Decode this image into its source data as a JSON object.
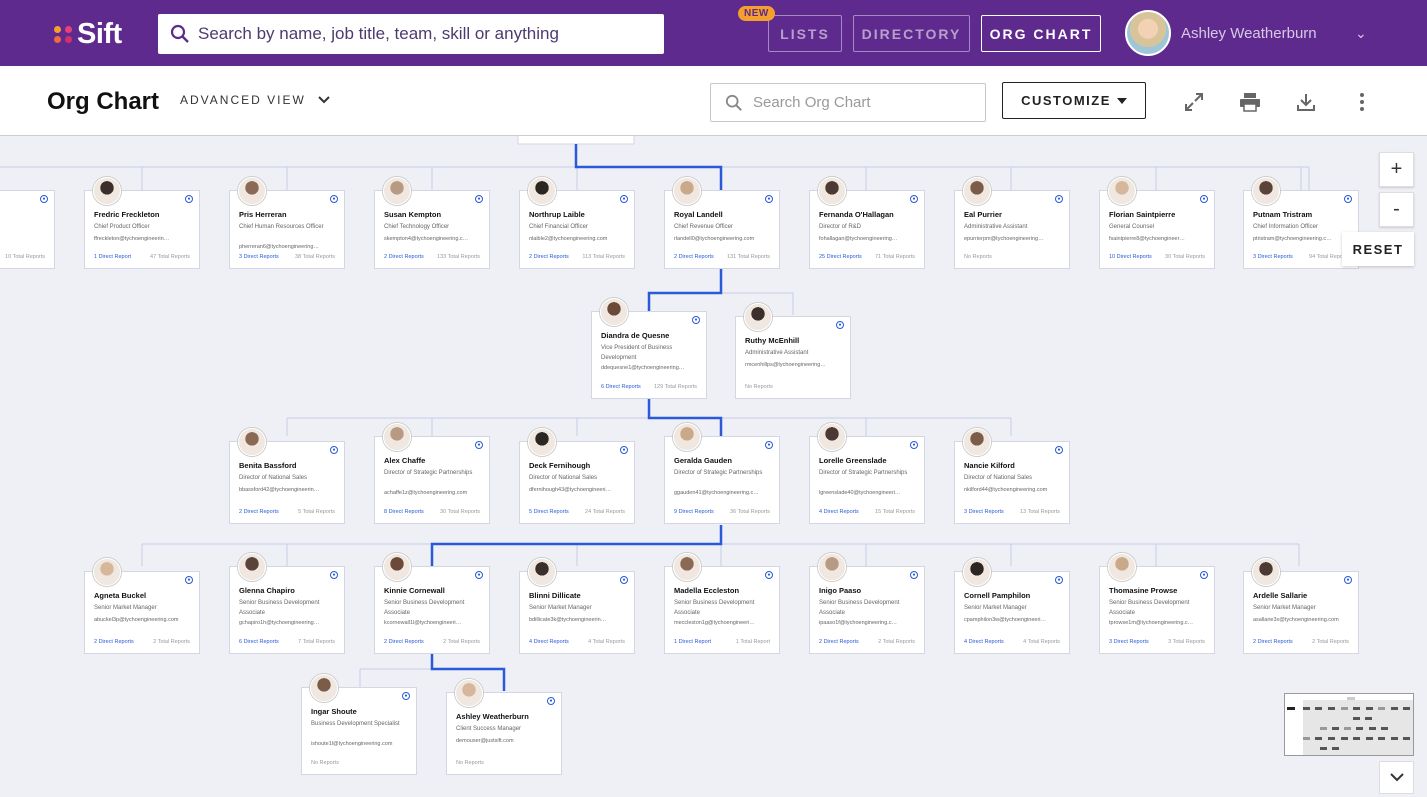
{
  "topbar": {
    "logo_text": "Sift",
    "search_placeholder": "Search by name, job title, team, skill or anything",
    "new_badge": "NEW",
    "nav": [
      {
        "label": "LISTS",
        "active": false
      },
      {
        "label": "DIRECTORY",
        "active": false
      },
      {
        "label": "ORG CHART",
        "active": true
      }
    ],
    "user_name": "Ashley Weatherburn"
  },
  "toolbar": {
    "title": "Org Chart",
    "view_label": "ADVANCED VIEW",
    "search_placeholder": "Search Org Chart",
    "customize_label": "CUSTOMIZE"
  },
  "controls": {
    "zoom_in": "+",
    "zoom_out": "-",
    "reset": "RESET"
  },
  "colors": {
    "brand": "#5f2a8e",
    "accent_line": "#2a5ad7",
    "badge": "#f5a02c"
  },
  "row1": [
    {
      "name": "…on",
      "title": "",
      "email": "…ngineering.com",
      "direct": "",
      "total": "10 Total Reports"
    },
    {
      "name": "Fredric Freckleton",
      "title": "Chief Product Officer",
      "email": "ffreckleton@tychoengineerin…",
      "direct": "1 Direct Report",
      "total": "47 Total Reports"
    },
    {
      "name": "Pris Herreran",
      "title": "Chief Human Resources Officer",
      "email": "pherreran6@tychoengineering…",
      "direct": "3 Direct Reports",
      "total": "38 Total Reports"
    },
    {
      "name": "Susan Kempton",
      "title": "Chief Technology Officer",
      "email": "skempton4@tychoengineering.c…",
      "direct": "2 Direct Reports",
      "total": "133 Total Reports"
    },
    {
      "name": "Northrup Laible",
      "title": "Chief Financial Officer",
      "email": "nlaible2@tychoengineering.com",
      "direct": "2 Direct Reports",
      "total": "113 Total Reports"
    },
    {
      "name": "Royal Landell",
      "title": "Chief Revenue Officer",
      "email": "rlandell0@tychoengineering.com",
      "direct": "2 Direct Reports",
      "total": "131 Total Reports"
    },
    {
      "name": "Fernanda O'Hallagan",
      "title": "Director of R&D",
      "email": "fohallagan@tychoengineering…",
      "direct": "25 Direct Reports",
      "total": "71 Total Reports"
    },
    {
      "name": "Eal Purrier",
      "title": "Administrative Assistant",
      "email": "epurrierpm@tychoengineering…",
      "direct": "",
      "total": "",
      "none": "No Reports"
    },
    {
      "name": "Florian Saintpierre",
      "title": "General Counsel",
      "email": "fsaintpierre8@tychoengineer…",
      "direct": "10 Direct Reports",
      "total": "30 Total Reports"
    },
    {
      "name": "Putnam Tristram",
      "title": "Chief Information Officer",
      "email": "ptristram@tychoengineering.c…",
      "direct": "3 Direct Reports",
      "total": "94 Total Reports"
    }
  ],
  "row2": [
    {
      "name": "Diandra de Quesne",
      "title": "Vice President of Business Development",
      "email": "ddequesne1@tychoengineering…",
      "direct": "6 Direct Reports",
      "total": "129 Total Reports"
    },
    {
      "name": "Ruthy McEnhill",
      "title": "Administrative Assistant",
      "email": "rmcenhillps@tychoengineering…",
      "direct": "",
      "total": "",
      "none": "No Reports"
    }
  ],
  "row3": [
    {
      "name": "Benita Bassford",
      "title": "Director of National Sales",
      "email": "bbassford42@tychoengineerin…",
      "direct": "2 Direct Reports",
      "total": "5 Total Reports"
    },
    {
      "name": "Alex Chaffe",
      "title": "Director of Strategic Partnerships",
      "email": "achaffe1z@tychoengineering.com",
      "direct": "8 Direct Reports",
      "total": "30 Total Reports"
    },
    {
      "name": "Deck Fernihough",
      "title": "Director of National Sales",
      "email": "dfernihough43@tychoengineeri…",
      "direct": "5 Direct Reports",
      "total": "24 Total Reports"
    },
    {
      "name": "Geralda Gauden",
      "title": "Director of Strategic Partnerships",
      "email": "ggauden41@tychoengineering.c…",
      "direct": "9 Direct Reports",
      "total": "36 Total Reports"
    },
    {
      "name": "Lorelle Greenslade",
      "title": "Director of Strategic Partnerships",
      "email": "lgreenslade40@tychoengineeri…",
      "direct": "4 Direct Reports",
      "total": "15 Total Reports"
    },
    {
      "name": "Nancie Kilford",
      "title": "Director of National Sales",
      "email": "nkilford44@tychoengineering.com",
      "direct": "3 Direct Reports",
      "total": "13 Total Reports"
    }
  ],
  "row4": [
    {
      "name": "Agneta Buckel",
      "title": "Senior Market Manager",
      "email": "abuckel3p@tychoengineering.com",
      "direct": "2 Direct Reports",
      "total": "2 Total Reports"
    },
    {
      "name": "Glenna Chapiro",
      "title": "Senior Business Development Associate",
      "email": "gchapiro1h@tychoengineering…",
      "direct": "6 Direct Reports",
      "total": "7 Total Reports"
    },
    {
      "name": "Kinnie Cornewall",
      "title": "Senior Business Development Associate",
      "email": "kcornewall1l@tychoengineeri…",
      "direct": "2 Direct Reports",
      "total": "2 Total Reports"
    },
    {
      "name": "Blinni Dillicate",
      "title": "Senior Market Manager",
      "email": "bdillicate3k@tychoengineerin…",
      "direct": "4 Direct Reports",
      "total": "4 Total Reports"
    },
    {
      "name": "Madella Eccleston",
      "title": "Senior Business Development Associate",
      "email": "meccleston1g@tychoengineeri…",
      "direct": "1 Direct Report",
      "total": "1 Total Report"
    },
    {
      "name": "Inigo Paaso",
      "title": "Senior Business Development Associate",
      "email": "ipaaso1f@tychoengineering.c…",
      "direct": "2 Direct Reports",
      "total": "2 Total Reports"
    },
    {
      "name": "Cornell Pamphilon",
      "title": "Senior Market Manager",
      "email": "cpamphilon3w@tychoengineeri…",
      "direct": "4 Direct Reports",
      "total": "4 Total Reports"
    },
    {
      "name": "Thomasine Prowse",
      "title": "Senior Business Development Associate",
      "email": "tprowse1m@tychoengineering.c…",
      "direct": "3 Direct Reports",
      "total": "3 Total Reports"
    },
    {
      "name": "Ardelle Sallarie",
      "title": "Senior Market Manager",
      "email": "asallarie3x@tychoengineering.com",
      "direct": "2 Direct Reports",
      "total": "2 Total Reports"
    }
  ],
  "row5": [
    {
      "name": "Ingar Shoute",
      "title": "Business Development Specialist",
      "email": "ishoute1l@tychoengineering.com",
      "direct": "",
      "total": "",
      "none": "No Reports"
    },
    {
      "name": "Ashley Weatherburn",
      "title": "Client Success Manager",
      "email": "demouser@justsift.com",
      "direct": "",
      "total": "",
      "none": "No Reports"
    }
  ]
}
